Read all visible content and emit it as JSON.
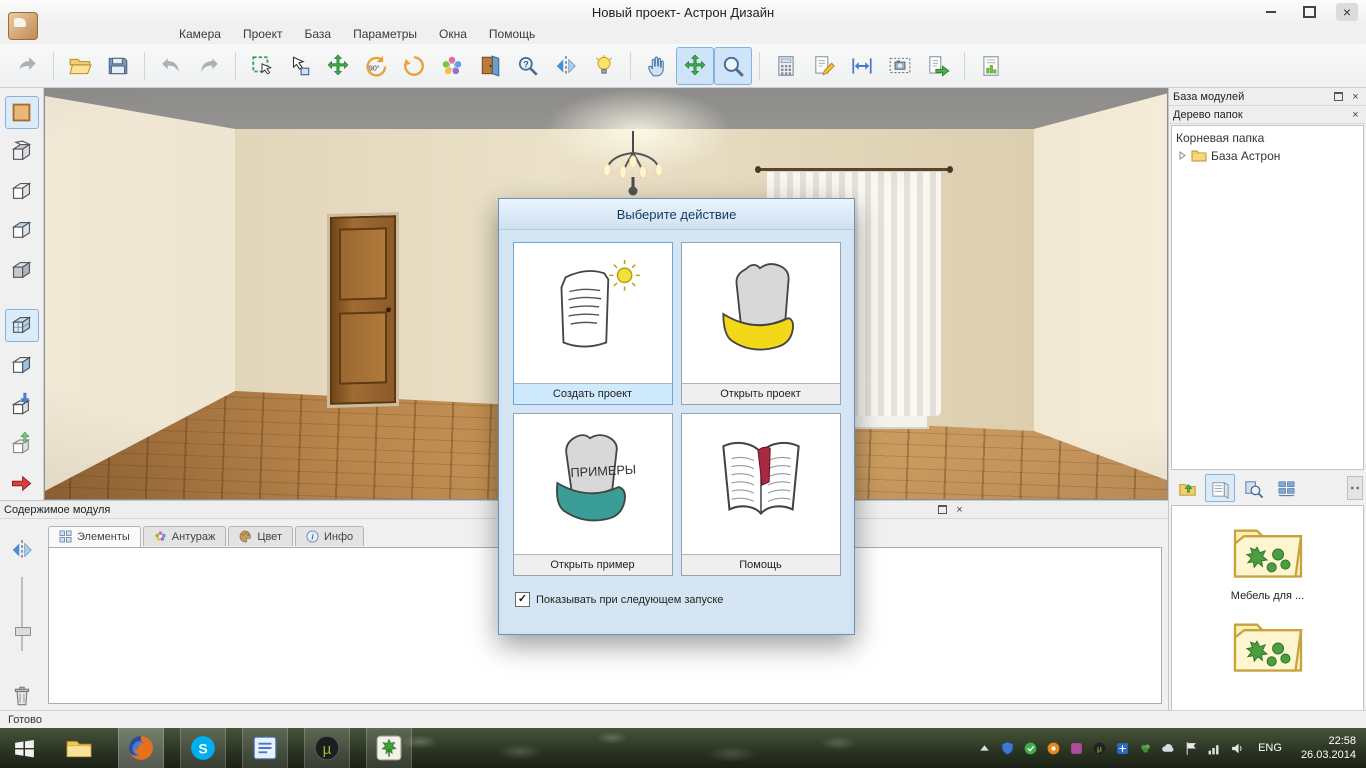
{
  "glyphs": {
    "close": "×",
    "check": "✓"
  },
  "window": {
    "title": "Новый проект- Астрон Дизайн"
  },
  "menu": {
    "items": [
      "Камера",
      "Проект",
      "База",
      "Параметры",
      "Окна",
      "Помощь"
    ]
  },
  "toolbar": {
    "rotate90_label": "90°",
    "groups": [
      [
        {
          "name": "forward",
          "icon": "arrow-forward"
        }
      ],
      [
        {
          "name": "open",
          "icon": "folder-open"
        },
        {
          "name": "save",
          "icon": "save"
        }
      ],
      [
        {
          "name": "undo",
          "icon": "undo"
        },
        {
          "name": "redo",
          "icon": "redo"
        }
      ],
      [
        {
          "name": "select",
          "icon": "select"
        },
        {
          "name": "select-object",
          "icon": "select-object"
        },
        {
          "name": "move-object",
          "icon": "move"
        },
        {
          "name": "rotate-90",
          "icon": "rotate90"
        },
        {
          "name": "rotate-free",
          "icon": "rotate"
        },
        {
          "name": "materials",
          "icon": "flower"
        },
        {
          "name": "doors",
          "icon": "door"
        },
        {
          "name": "search-object",
          "icon": "zoom-question"
        },
        {
          "name": "mirror",
          "icon": "mirror"
        },
        {
          "name": "light",
          "icon": "bulb"
        }
      ],
      [
        {
          "name": "pan",
          "icon": "hand"
        },
        {
          "name": "move-view",
          "icon": "move",
          "active": true
        },
        {
          "name": "zoom",
          "icon": "zoom",
          "active": true
        }
      ],
      [
        {
          "name": "estimate",
          "icon": "calc"
        },
        {
          "name": "edit-document",
          "icon": "edit-doc"
        },
        {
          "name": "dimensions",
          "icon": "resize-h"
        },
        {
          "name": "snapshot",
          "icon": "camera-frame"
        },
        {
          "name": "export",
          "icon": "export-doc"
        }
      ],
      [
        {
          "name": "report",
          "icon": "report"
        }
      ]
    ]
  },
  "left_toolbar": {
    "items": [
      {
        "name": "walls",
        "icon": "wall",
        "active": true
      },
      {
        "name": "box-open",
        "icon": "cube-open"
      },
      {
        "name": "box-closed",
        "icon": "cube"
      },
      {
        "name": "box-top",
        "icon": "cube-top"
      },
      {
        "name": "box-solid",
        "icon": "cube-solid"
      },
      {
        "name": "view-room",
        "icon": "cube-grid",
        "active": true
      },
      {
        "name": "box-section",
        "icon": "cube-section"
      },
      {
        "name": "box-import",
        "icon": "box-import"
      },
      {
        "name": "box-raise",
        "icon": "box-export"
      },
      {
        "name": "apply",
        "icon": "red-arrow"
      }
    ]
  },
  "dialog": {
    "title": "Выберите действие",
    "tiles": [
      {
        "label": "Создать проект",
        "selected": true
      },
      {
        "label": "Открыть проект"
      },
      {
        "label": "Открыть пример"
      },
      {
        "label": "Помощь"
      }
    ],
    "examples_text": "ПРИМЕРЫ",
    "checkbox_label": "Показывать при следующем запуске",
    "checkbox_checked": true
  },
  "right_panel": {
    "title": "База модулей",
    "tree_title": "Дерево папок",
    "tree": {
      "root_label": "Корневая папка",
      "child_label": "База Астрон"
    },
    "toolbar": [
      {
        "name": "up-level",
        "icon": "rp-up"
      },
      {
        "name": "module-view",
        "icon": "rp-module",
        "active": true
      },
      {
        "name": "module-search",
        "icon": "rp-search"
      },
      {
        "name": "grid-view",
        "icon": "rp-grid"
      }
    ],
    "folders": [
      {
        "label": "Мебель для ..."
      },
      {
        "label": ""
      }
    ]
  },
  "bottom_panel": {
    "title": "Содержимое модуля",
    "tabs": [
      {
        "name": "elements",
        "label": "Элементы",
        "icon": "tab-grid",
        "active": true
      },
      {
        "name": "entourage",
        "label": "Антураж",
        "icon": "tab-flower"
      },
      {
        "name": "color",
        "label": "Цвет",
        "icon": "tab-palette"
      },
      {
        "name": "info",
        "label": "Инфо",
        "icon": "tab-info"
      }
    ]
  },
  "status_bar": {
    "text": "Готово"
  },
  "taskbar": {
    "apps": [
      {
        "name": "start",
        "icon": "app-start"
      },
      {
        "name": "explorer",
        "icon": "app-explorer"
      },
      {
        "name": "firefox",
        "icon": "app-firefox",
        "active": true,
        "bright": true
      },
      {
        "name": "skype",
        "icon": "app-skype",
        "active": true
      },
      {
        "name": "editor",
        "icon": "app-editor",
        "active": true
      },
      {
        "name": "utorrent",
        "icon": "app-utorrent",
        "active": true
      },
      {
        "name": "astron",
        "icon": "app-astron",
        "active": true
      }
    ],
    "tray": [
      {
        "name": "show-hidden",
        "icon": "tray-up"
      },
      {
        "name": "security",
        "icon": "tray-shield"
      },
      {
        "name": "status-green",
        "icon": "tray-green"
      },
      {
        "name": "status-orange",
        "icon": "tray-orange"
      },
      {
        "name": "status-magenta",
        "icon": "tray-magenta"
      },
      {
        "name": "utorrent",
        "icon": "tray-u"
      },
      {
        "name": "status-blue",
        "icon": "tray-blue"
      },
      {
        "name": "leaf",
        "icon": "tray-leaf"
      },
      {
        "name": "cloud",
        "icon": "tray-cloud"
      },
      {
        "name": "flag",
        "icon": "tray-flag"
      },
      {
        "name": "network",
        "icon": "tray-net"
      },
      {
        "name": "volume",
        "icon": "tray-vol"
      }
    ],
    "language": "ENG",
    "time": "22:58",
    "date": "26.03.2014"
  }
}
